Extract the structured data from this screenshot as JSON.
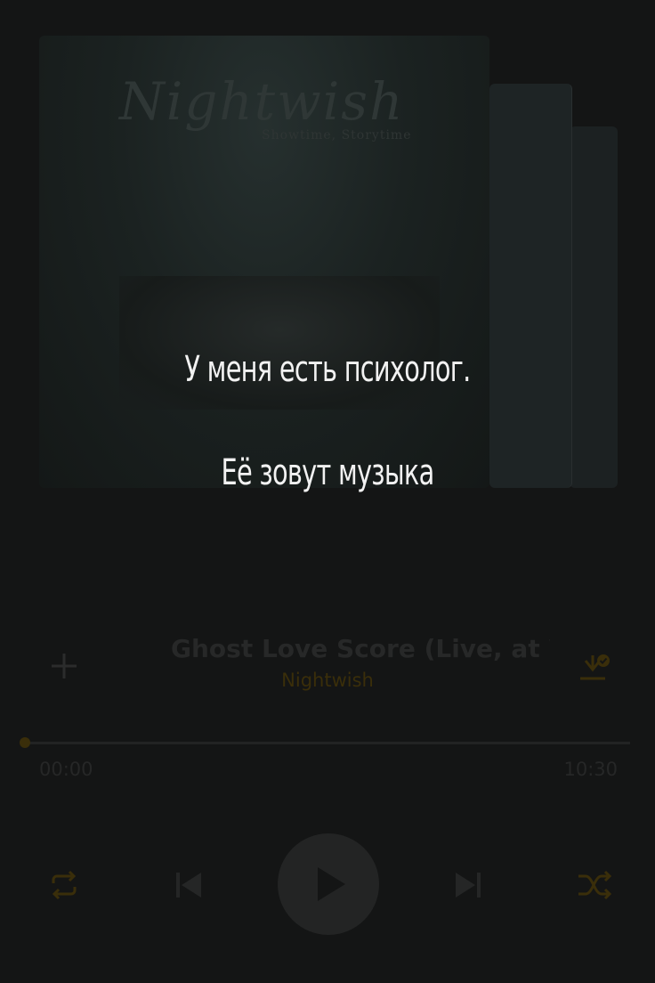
{
  "overlay": {
    "line1": "У меня есть психолог.",
    "line2": "Её зовут музыка"
  },
  "cover": {
    "band_logo_text": "Nightwish",
    "album_subtitle": "Showtime, Storytime"
  },
  "track": {
    "title": "Ghost Love Score (Live, at Wa",
    "artist": "Nightwish"
  },
  "progress": {
    "elapsed": "00:00",
    "total": "10:30",
    "fraction": 0
  },
  "icons": {
    "add": "plus-icon",
    "download": "download-check-icon",
    "repeat": "repeat-icon",
    "previous": "skip-previous-icon",
    "play": "play-icon",
    "next": "skip-next-icon",
    "shuffle": "shuffle-icon"
  },
  "colors": {
    "background": "#141515",
    "accent": "#3a2e0a",
    "overlay_text": "#f2f2f2"
  }
}
